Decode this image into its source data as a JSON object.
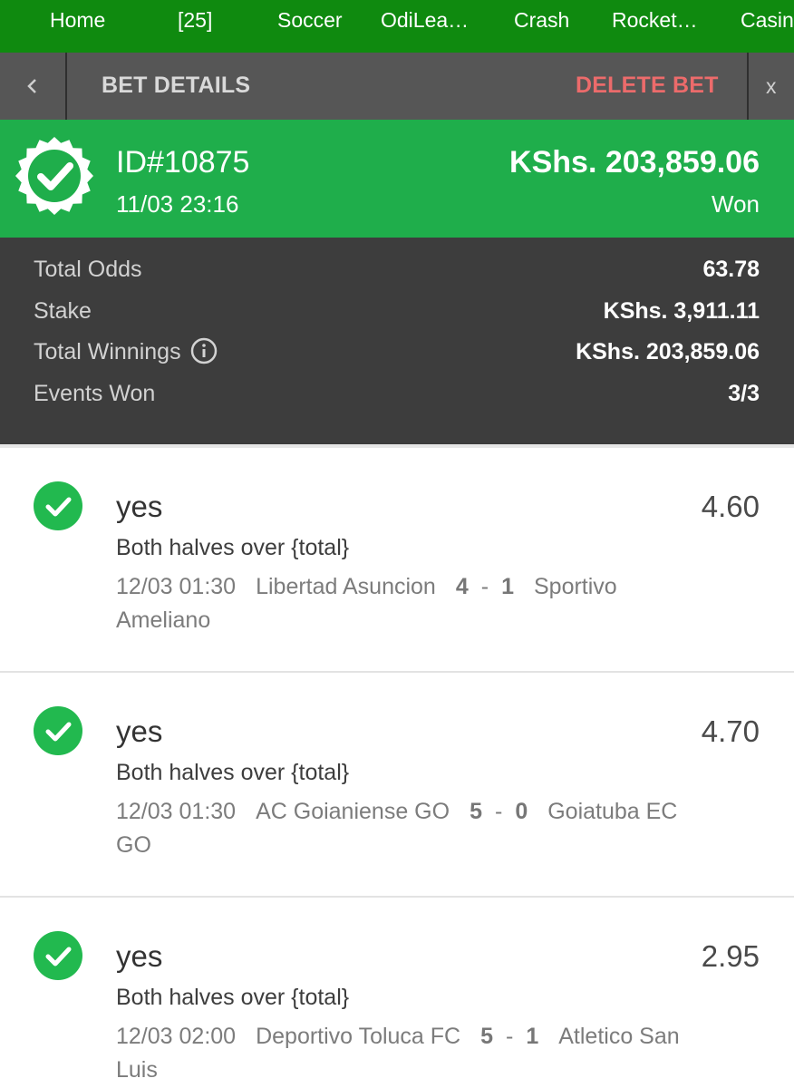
{
  "nav": {
    "items": [
      "Home",
      "[25]",
      "Soccer",
      "OdiLea…",
      "Crash",
      "Rocket…",
      "Casin"
    ]
  },
  "header": {
    "back_icon": "chevron-left-icon",
    "title": "BET DETAILS",
    "delete_label": "DELETE BET",
    "close_label": "x"
  },
  "bet": {
    "id": "ID#10875",
    "placed": "11/03 23:16",
    "amount": "KShs. 203,859.06",
    "status": "Won",
    "status_icon": "check-badge-icon",
    "banner_color": "#1fae4b"
  },
  "summary": {
    "total_odds_label": "Total Odds",
    "total_odds": "63.78",
    "stake_label": "Stake",
    "stake": "KShs. 3,911.11",
    "winnings_label": "Total Winnings",
    "winnings": "KShs. 203,859.06",
    "events_won_label": "Events Won",
    "events_won": "3/3"
  },
  "events": [
    {
      "pick": "yes",
      "odds": "4.60",
      "market": "Both halves over {total}",
      "time": "12/03 01:30",
      "home": "Libertad Asuncion",
      "home_score": "4",
      "away_score": "1",
      "away": "Sportivo Ameliano"
    },
    {
      "pick": "yes",
      "odds": "4.70",
      "market": "Both halves over {total}",
      "time": "12/03 01:30",
      "home": "AC Goianiense GO",
      "home_score": "5",
      "away_score": "0",
      "away": "Goiatuba EC GO"
    },
    {
      "pick": "yes",
      "odds": "2.95",
      "market": "Both halves over {total}",
      "time": "12/03 02:00",
      "home": "Deportivo Toluca FC",
      "home_score": "5",
      "away_score": "1",
      "away": "Atletico San Luis"
    }
  ],
  "colors": {
    "nav_bg": "#0f8a0f",
    "won_green": "#1fae4b",
    "delete_red": "#ec6b6b"
  }
}
